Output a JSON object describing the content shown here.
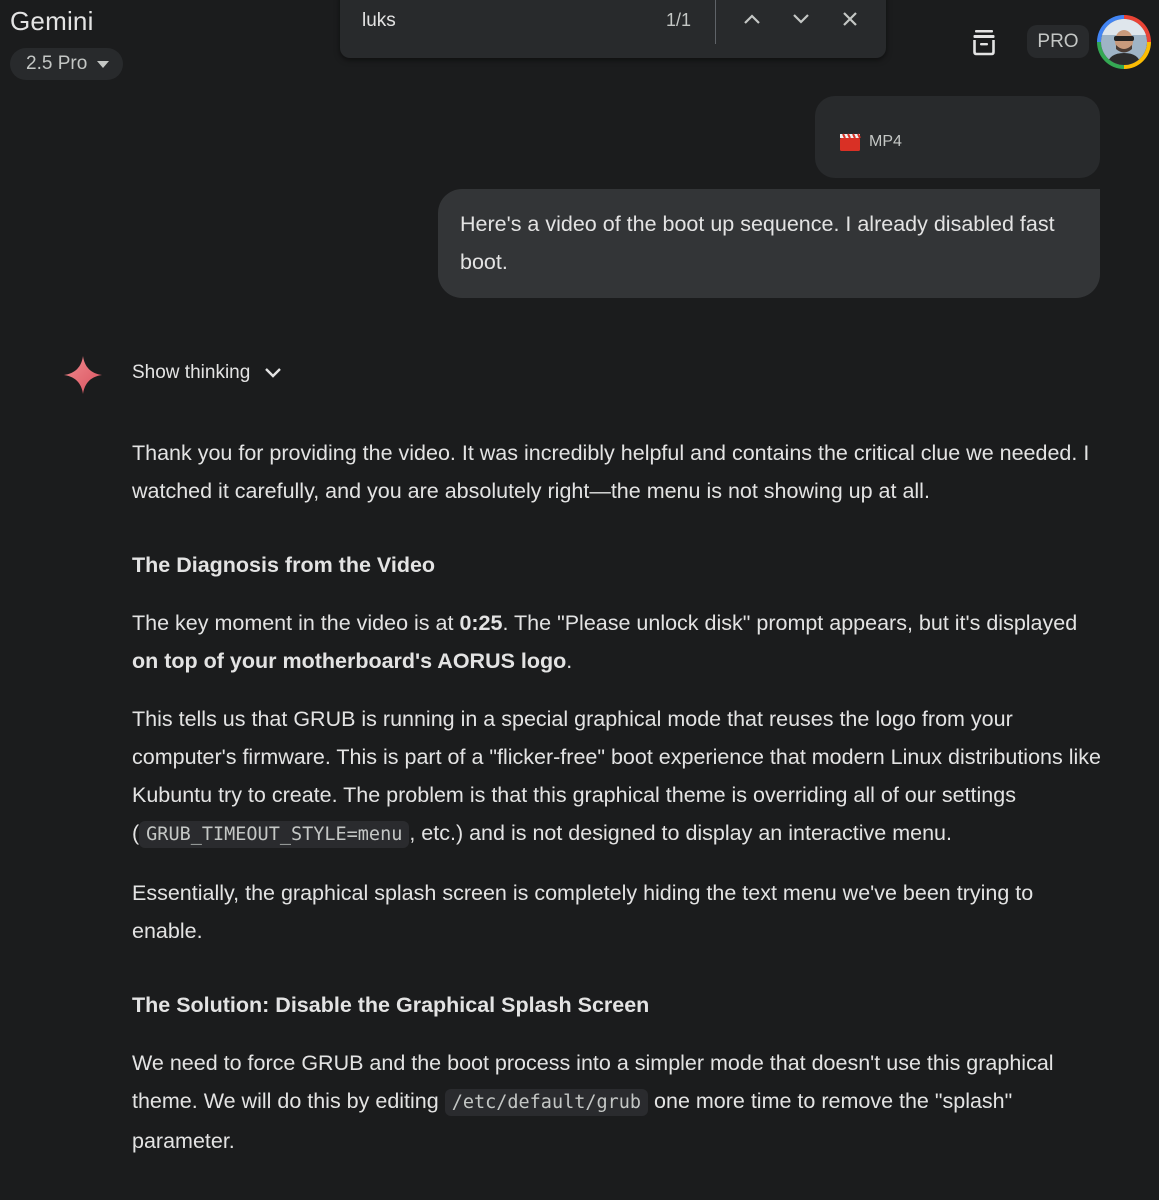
{
  "header": {
    "app_title": "Gemini",
    "model_label": "2.5 Pro",
    "pro_badge": "PRO"
  },
  "find_bar": {
    "query": "luks",
    "match_count": "1/1"
  },
  "conversation": {
    "attachment_label": "MP4",
    "user_message": "Here's a video of the boot up sequence. I already disabled fast boot.",
    "show_thinking_label": "Show thinking",
    "response": {
      "p1": "Thank you for providing the video. It was incredibly helpful and contains the critical clue we needed. I watched it carefully, and you are absolutely right—the menu is not showing up at all.",
      "h1": "The Diagnosis from the Video",
      "p2_a": "The key moment in the video is at ",
      "p2_b": "0:25",
      "p2_c": ". The \"Please unlock disk\" prompt appears, but it's displayed ",
      "p2_d": "on top of your motherboard's AORUS logo",
      "p2_e": ".",
      "p3_a": "This tells us that GRUB is running in a special graphical mode that reuses the logo from your computer's firmware. This is part of a \"flicker-free\" boot experience that modern Linux distributions like Kubuntu try to create. The problem is that this graphical theme is overriding all of our settings (",
      "p3_code": "GRUB_TIMEOUT_STYLE=menu",
      "p3_b": ", etc.) and is not designed to display an interactive menu.",
      "p4": "Essentially, the graphical splash screen is completely hiding the text menu we've been trying to enable.",
      "h2": "The Solution: Disable the Graphical Splash Screen",
      "p5_a": "We need to force GRUB and the boot process into a simpler mode that doesn't use this graphical theme. We will do this by editing ",
      "p5_code": "/etc/default/grub",
      "p5_b": " one more time to remove the \"splash\" parameter."
    }
  },
  "colors": {
    "background": "#1b1c1d",
    "bubble": "#333537",
    "spark": "#e46b74"
  }
}
